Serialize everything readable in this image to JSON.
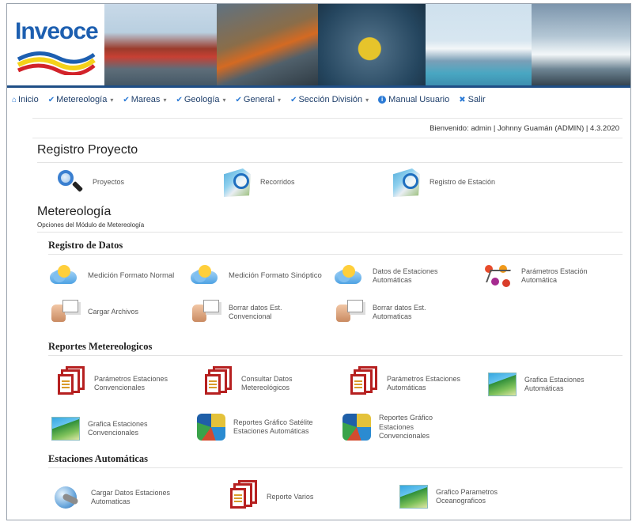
{
  "brand": {
    "logo_text": "Inveoce"
  },
  "nav": {
    "items": [
      {
        "label": "Inicio",
        "dropdown": false
      },
      {
        "label": "Metereología",
        "dropdown": true
      },
      {
        "label": "Mareas",
        "dropdown": true
      },
      {
        "label": "Geología",
        "dropdown": true
      },
      {
        "label": "General",
        "dropdown": true
      },
      {
        "label": "Sección División",
        "dropdown": true
      },
      {
        "label": "Manual Usuario",
        "dropdown": false
      },
      {
        "label": "Salir",
        "dropdown": false
      }
    ],
    "caret": "▾"
  },
  "welcome": "Bienvenido: admin | Johnny Guamán (ADMIN) | 4.3.2020",
  "registro_proyecto": {
    "title": "Registro Proyecto",
    "items": [
      {
        "label": "Proyectos",
        "icon": "search-icon"
      },
      {
        "label": "Recorridos",
        "icon": "map-search-icon"
      },
      {
        "label": "Registro de Estación",
        "icon": "map-search-icon"
      }
    ]
  },
  "metereologia": {
    "title": "Metereología",
    "subtitle": "Opciones del Módulo de Metereología",
    "registro_datos": {
      "title": "Registro de Datos",
      "items": [
        {
          "label": "Medición Formato Normal",
          "icon": "weather-cloud-icon"
        },
        {
          "label": "Medición Formato Sinóptico",
          "icon": "weather-cloud-icon"
        },
        {
          "label": "Datos de Estaciones Automáticas",
          "icon": "weather-cloud-icon"
        },
        {
          "label": "Parámetros Estación Automática",
          "icon": "molecule-icon"
        },
        {
          "label": "Cargar Archivos",
          "icon": "upload-hand-icon"
        },
        {
          "label": "Borrar datos Est. Convencional",
          "icon": "upload-hand-icon"
        },
        {
          "label": "Borrar datos Est. Automaticas",
          "icon": "upload-hand-icon"
        }
      ]
    },
    "reportes": {
      "title": "Reportes Metereologicos",
      "items": [
        {
          "label": "Parámetros Estaciones Convencionales",
          "icon": "documents-icon"
        },
        {
          "label": "Consultar Datos Metereológicos",
          "icon": "documents-icon"
        },
        {
          "label": "Parámetros Estaciones Automáticas",
          "icon": "documents-icon"
        },
        {
          "label": "Grafica Estaciones Automáticas",
          "icon": "map-chart-icon"
        },
        {
          "label": "Grafica Estaciones Convencionales",
          "icon": "map-chart-icon"
        },
        {
          "label": "Reportes Gráfico Satélite Estaciones Automáticas",
          "icon": "satellite-map-icon"
        },
        {
          "label": "Reportes Gráfico Estaciones Convencionales",
          "icon": "satellite-map-icon"
        }
      ]
    },
    "automaticas": {
      "title": "Estaciones Automáticas",
      "items": [
        {
          "label": "Cargar Datos Estaciones Automaticas",
          "icon": "globe-icon"
        },
        {
          "label": "Reporte Varios",
          "icon": "documents-icon"
        },
        {
          "label": "Grafico Parametros Oceanograficos",
          "icon": "map-chart-icon"
        }
      ]
    }
  }
}
